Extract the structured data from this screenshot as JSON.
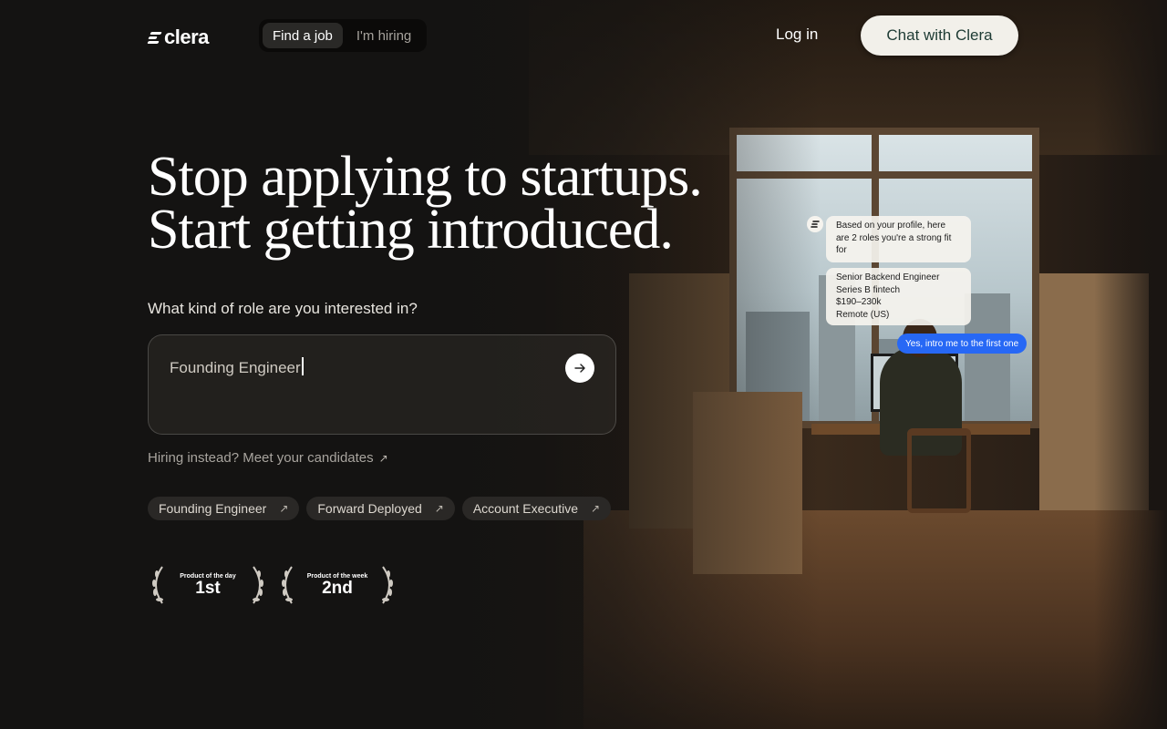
{
  "nav": {
    "logo_text": "clera",
    "toggle": [
      "Find a job",
      "I'm hiring"
    ],
    "login": "Log in",
    "cta": "Chat with Clera"
  },
  "hero": {
    "line1": "Stop applying to startups.",
    "line2": "Start getting introduced."
  },
  "search": {
    "question": "What kind of role are you interested in?",
    "value": "Founding Engineer"
  },
  "hiring_link": "Hiring instead? Meet your candidates",
  "chips": [
    "Founding Engineer",
    "Forward Deployed",
    "Account Executive"
  ],
  "badges": [
    {
      "label": "Product of the day",
      "rank": "1st"
    },
    {
      "label": "Product of the week",
      "rank": "2nd"
    }
  ],
  "chat": {
    "message1": "Based on your profile, here are 2 roles you're a strong fit for",
    "role_lines": [
      "Senior Backend Engineer",
      "Series B fintech",
      "$190–230k",
      "Remote (US)"
    ],
    "reply": "Yes, intro me to the first one"
  },
  "colors": {
    "cta_bg": "#f2f0ea",
    "cta_text": "#1e3b34",
    "reply_bubble": "#2768f5"
  }
}
